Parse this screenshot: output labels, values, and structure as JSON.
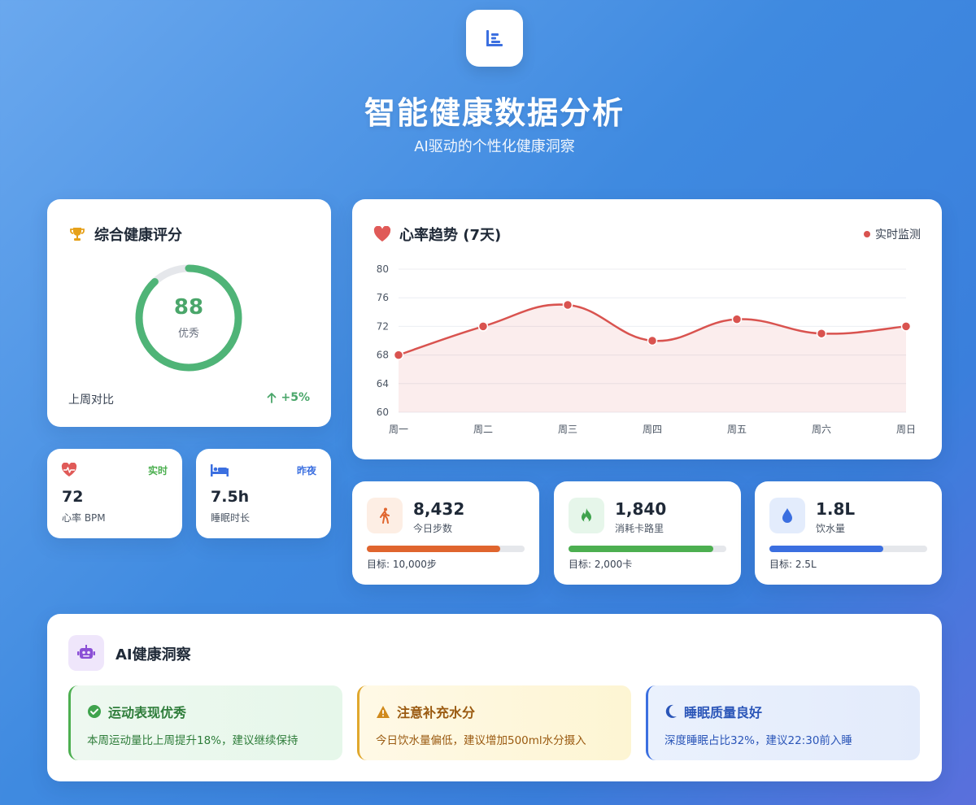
{
  "header": {
    "logo_icon": "bar-chart-icon",
    "title": "智能健康数据分析",
    "subtitle": "AI驱动的个性化健康洞察"
  },
  "score_card": {
    "icon": "trophy-icon",
    "title": "综合健康评分",
    "score": "88",
    "score_fraction": 0.88,
    "grade": "优秀",
    "compare_label": "上周对比",
    "compare_value": "+5%",
    "accent": "#4fb477"
  },
  "mini_cards": {
    "heart_rate": {
      "icon": "heart-pulse-icon",
      "tag": "实时",
      "value": "72",
      "label": "心率 BPM",
      "tag_color": "#4caf50"
    },
    "sleep": {
      "icon": "bed-icon",
      "tag": "昨夜",
      "value": "7.5h",
      "label": "睡眠时长",
      "tag_color": "#3b6fe0"
    }
  },
  "heart_chart": {
    "icon": "heart-icon",
    "title": "心率趋势 (7天)",
    "live_label": "实时监测"
  },
  "chart_data": {
    "type": "area",
    "categories": [
      "周一",
      "周二",
      "周三",
      "周四",
      "周五",
      "周六",
      "周日"
    ],
    "series": [
      {
        "values": [
          68,
          72,
          75,
          70,
          73,
          71,
          72
        ]
      }
    ],
    "ylim": [
      60,
      80
    ],
    "yticks": [
      60,
      64,
      68,
      72,
      76,
      80
    ],
    "grid": true,
    "color": "#d9534f"
  },
  "stats": {
    "steps": {
      "icon": "walking-icon",
      "value": "8,432",
      "label": "今日步数",
      "goal": "目标: 10,000步",
      "progress": 0.843,
      "color": "#e0652e",
      "icon_bg": "#fdeee4"
    },
    "calories": {
      "icon": "fire-icon",
      "value": "1,840",
      "label": "消耗卡路里",
      "goal": "目标: 2,000卡",
      "progress": 0.92,
      "color": "#4caf50",
      "icon_bg": "#e6f6ea"
    },
    "water": {
      "icon": "water-drop-icon",
      "value": "1.8L",
      "label": "饮水量",
      "goal": "目标: 2.5L",
      "progress": 0.72,
      "color": "#3b6fe0",
      "icon_bg": "#e3ecfc"
    }
  },
  "insights": {
    "icon": "robot-icon",
    "title": "AI健康洞察",
    "items": [
      {
        "icon": "check-circle-icon",
        "title": "运动表现优秀",
        "text": "本周运动量比上周提升18%，建议继续保持",
        "color": "#2e7d3a"
      },
      {
        "icon": "warning-icon",
        "title": "注意补充水分",
        "text": "今日饮水量偏低，建议增加500ml水分摄入",
        "color": "#9a5a10"
      },
      {
        "icon": "moon-icon",
        "title": "睡眠质量良好",
        "text": "深度睡眠占比32%，建议22:30前入睡",
        "color": "#2a55b8"
      }
    ]
  }
}
